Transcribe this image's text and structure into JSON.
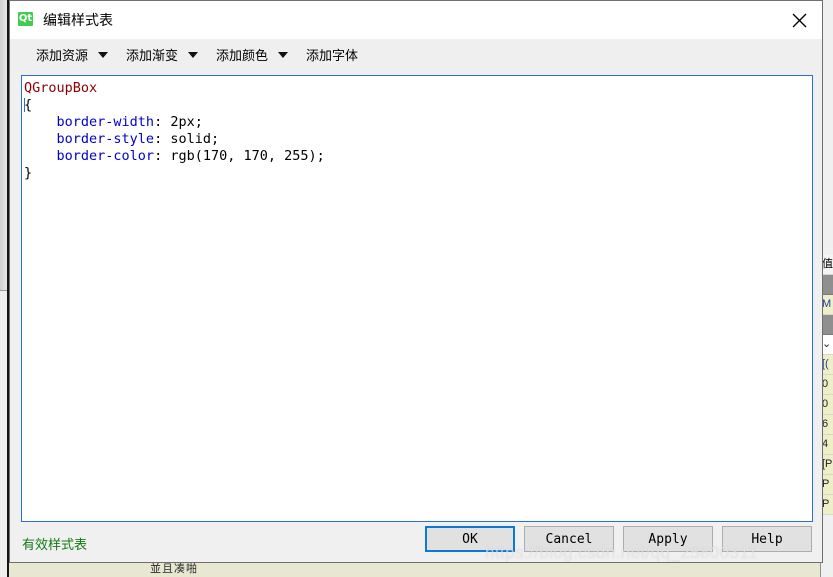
{
  "window": {
    "title": "编辑样式表",
    "icon": "qt-logo-icon",
    "icon_text": "Qt",
    "close_label": "✕"
  },
  "toolbar": {
    "items": [
      {
        "label": "添加资源",
        "has_dropdown": true
      },
      {
        "label": "添加渐变",
        "has_dropdown": true
      },
      {
        "label": "添加颜色",
        "has_dropdown": true
      },
      {
        "label": "添加字体",
        "has_dropdown": false
      }
    ]
  },
  "editor": {
    "selector": "QGroupBox",
    "brace_open": "{",
    "brace_close": "}",
    "declarations": [
      {
        "property": "border-width",
        "separator": ": ",
        "value": "2px;"
      },
      {
        "property": "border-style",
        "separator": ": ",
        "value": "solid;"
      },
      {
        "property": "border-color",
        "separator": ": ",
        "value": "rgb(170, 170, 255);"
      }
    ],
    "indent": "    "
  },
  "footer": {
    "status": "有效样式表",
    "status_color": "#127a12",
    "buttons": [
      {
        "label": "OK",
        "default": true
      },
      {
        "label": "Cancel",
        "default": false
      },
      {
        "label": "Apply",
        "default": false
      },
      {
        "label": "Help",
        "default": false
      }
    ]
  },
  "watermark": "https://blog.csdn.net/qq_25800311",
  "background": {
    "bottom_label": "並且凑啪",
    "property_rows": [
      {
        "text": "值",
        "style": "hdr"
      },
      {
        "text": "",
        "style": "grey"
      },
      {
        "text": "M",
        "style": "blue"
      },
      {
        "text": "",
        "style": "grey"
      },
      {
        "text": "⌄",
        "style": "white"
      },
      {
        "text": "[(",
        "style": "blue"
      },
      {
        "text": "0",
        "style": ""
      },
      {
        "text": "0",
        "style": ""
      },
      {
        "text": "6",
        "style": ""
      },
      {
        "text": "4",
        "style": ""
      },
      {
        "text": "[P",
        "style": ""
      },
      {
        "text": "P",
        "style": ""
      },
      {
        "text": "P",
        "style": ""
      }
    ]
  },
  "colors": {
    "accent": "#0a79d7",
    "editor_border": "#2b6fd6",
    "selector_token": "#8b0000",
    "property_token": "#0000d0",
    "qt_green": "#41cd52"
  }
}
